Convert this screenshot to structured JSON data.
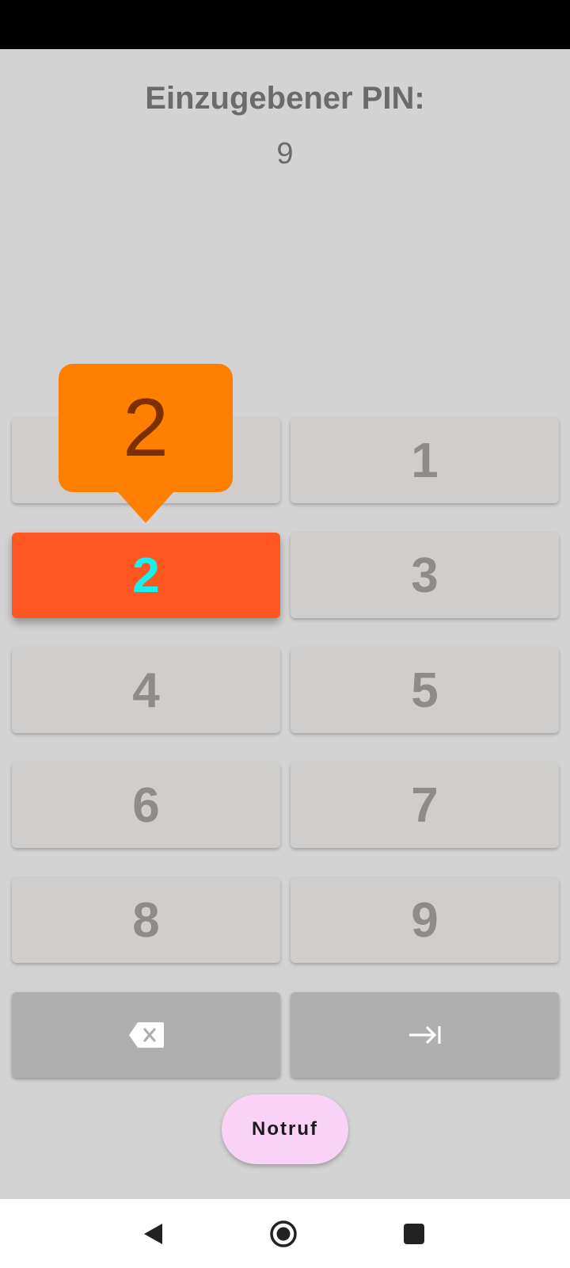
{
  "pin": {
    "label": "Einzugebener PIN:",
    "value": "9"
  },
  "popup": {
    "value": "2"
  },
  "keys": [
    {
      "label": "",
      "name": "key-0"
    },
    {
      "label": "1",
      "name": "key-1"
    },
    {
      "label": "2",
      "name": "key-2"
    },
    {
      "label": "3",
      "name": "key-3"
    },
    {
      "label": "4",
      "name": "key-4"
    },
    {
      "label": "5",
      "name": "key-5"
    },
    {
      "label": "6",
      "name": "key-6"
    },
    {
      "label": "7",
      "name": "key-7"
    },
    {
      "label": "8",
      "name": "key-8"
    },
    {
      "label": "9",
      "name": "key-9"
    }
  ],
  "function_keys": {
    "backspace_icon": "backspace-icon",
    "submit_icon": "tab-arrow-icon"
  },
  "emergency": {
    "label": "Notruf"
  },
  "nav": {
    "back_icon": "back-triangle-icon",
    "home_icon": "home-circle-icon",
    "recents_icon": "recents-square-icon"
  },
  "colors": {
    "background": "#d3d3d3",
    "key": "#cfcecd",
    "key_active": "#ff5722",
    "key_active_text": "#18f0f0",
    "popup": "#ff7f00",
    "function_key": "#afafaf",
    "emergency_button": "#f9d3f5"
  }
}
